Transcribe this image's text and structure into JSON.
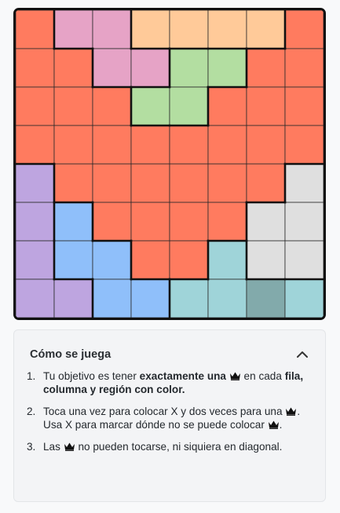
{
  "board": {
    "size": 8,
    "regions": [
      [
        0,
        1,
        1,
        2,
        2,
        2,
        2,
        0
      ],
      [
        0,
        0,
        1,
        1,
        3,
        3,
        0,
        0
      ],
      [
        0,
        0,
        0,
        3,
        3,
        0,
        0,
        0
      ],
      [
        0,
        0,
        0,
        0,
        0,
        0,
        0,
        0
      ],
      [
        4,
        0,
        0,
        0,
        0,
        0,
        0,
        5
      ],
      [
        4,
        6,
        0,
        0,
        0,
        0,
        5,
        5
      ],
      [
        4,
        6,
        6,
        0,
        0,
        7,
        5,
        5
      ],
      [
        4,
        4,
        6,
        6,
        7,
        7,
        7,
        7
      ]
    ],
    "region_colors": [
      "#ff7b5f",
      "#e6a3c6",
      "#ffca99",
      "#b3dea1",
      "#bea5e0",
      "#dfdfdf",
      "#8fbffa",
      "#9fd4d9"
    ],
    "highlight_cell": {
      "row": 7,
      "col": 6,
      "color": "#82aaab"
    }
  },
  "instructions": {
    "title": "Cómo se juega",
    "steps": [
      {
        "num": "1.",
        "before": "Tu objetivo es tener ",
        "bold": "exactamente una",
        "middle": " en cada ",
        "bold2": "fila, columna y región con color."
      },
      {
        "num": "2.",
        "text_a": "Toca una vez para colocar X y dos veces para una",
        "text_b": ". Usa X para marcar dónde no se puede colocar",
        "text_c": "."
      },
      {
        "num": "3.",
        "text_a": "Las",
        "text_b": " no pueden tocarse, ni siquiera en diagonal."
      }
    ]
  },
  "icons": {
    "collapse": "chevron-up-icon",
    "piece": "crown-icon"
  }
}
